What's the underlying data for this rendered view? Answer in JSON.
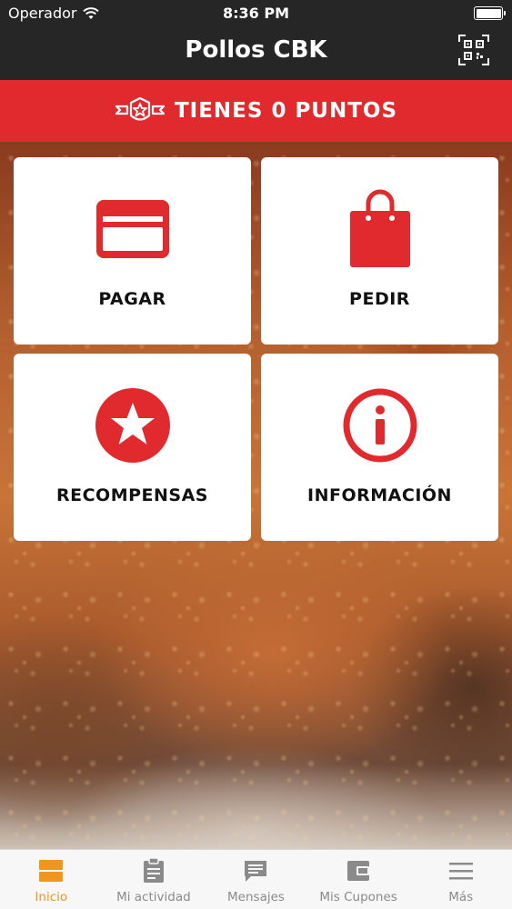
{
  "status_bar": {
    "carrier": "Operador",
    "time": "8:36 PM"
  },
  "nav": {
    "title": "Pollos CBK"
  },
  "points_banner": {
    "label": "TIENES 0 PUNTOS"
  },
  "tiles": {
    "pay": "PAGAR",
    "order": "PEDIR",
    "rewards": "RECOMPENSAS",
    "info": "INFORMACIÓN"
  },
  "tabbar": {
    "items": [
      {
        "label": "Inicio",
        "icon": "home-icon"
      },
      {
        "label": "Mi actividad",
        "icon": "clipboard-icon"
      },
      {
        "label": "Mensajes",
        "icon": "message-icon"
      },
      {
        "label": "Mis Cupones",
        "icon": "wallet-icon"
      },
      {
        "label": "Más",
        "icon": "menu-icon"
      }
    ]
  },
  "colors": {
    "brand_red": "#e02a2e",
    "active_tab": "#f0951d",
    "nav_bg": "#262626"
  }
}
